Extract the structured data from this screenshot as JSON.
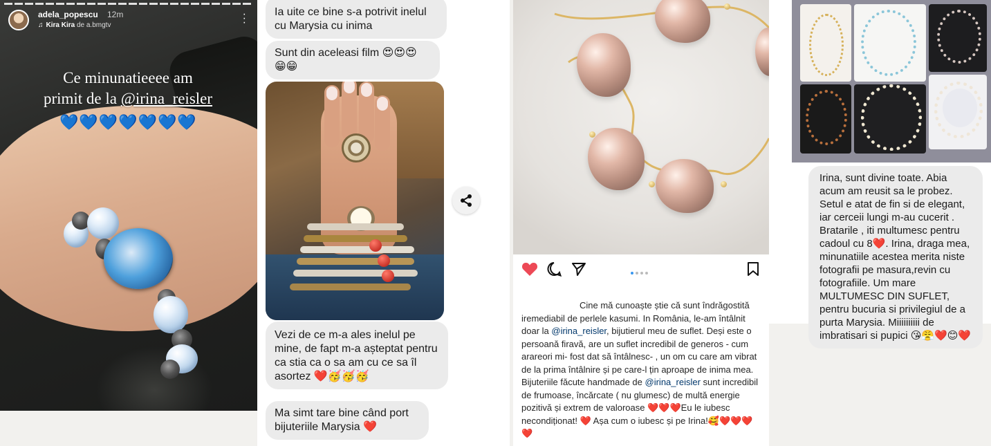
{
  "story": {
    "username": "adela_popescu",
    "time": "12m",
    "music_track": "Kira Kira",
    "music_artist": "de a.bmgtv",
    "caption_line1": "Ce minunatieeee am",
    "caption_line2_prefix": "primit de la ",
    "caption_mention": "@irina_reisler",
    "caption_hearts": "💙💙💙💙💙💙💙"
  },
  "chat": {
    "messages": [
      "Ia uite ce bine s-a potrivit inelul cu Marysia cu inima",
      "Sunt din aceleasi film 😍😍😍 😁😁",
      "Vezi de ce m-a ales inelul pe mine, de fapt m-a așteptat pentru ca stia ca o sa am cu ce sa îl asortez ❤️🥳🥳🥳",
      "Ma simt tare bine când port bijuteriile Marysia ❤️"
    ]
  },
  "post": {
    "carousel_index": 1,
    "carousel_count": 4,
    "text_part1": "Cine mă cunoaște știe că sunt îndrăgostită iremediabil de perlele kasumi. In România, le-am întâlnit doar  la ",
    "mention1": "@irina_reisler",
    "text_part2": ", bijutierul meu de suflet. Deși este o persoană firavă, are un suflet incredibil de generos - cum arareori mi- fost dat să întâlnesc- , un om cu care am vibrat de la prima întâlnire și pe care-l țin aproape de inima mea.  Bijuteriile făcute handmade de ",
    "mention2": "@irina_reisler",
    "text_part3": " sunt incredibil de frumoase, încărcate ( nu glumesc) de multă energie pozitivă și extrem de valoroase ❤️❤️❤️Eu le iubesc necondiționat! ❤️ Așa cum o iubesc și pe Irina!🥰❤️❤️❤️❤️"
  },
  "review": {
    "message": "Irina, sunt divine toate. Abia acum am reusit sa le probez. Setul e atat de fin si de elegant, iar cerceii lungi m-au cucerit . Bratarile , iti multumesc pentru cadoul cu 8❤️. Irina, draga mea, minunatiile acestea merita niste fotografii pe masura,revin cu fotografiile. Um mare MULTUMESC DIN SUFLET, pentru bucuria si privilegiul de a purta Marysia. Miiiiiiiiii de imbratisari si pupici 😘😤❤️😊❤️"
  },
  "colors": {
    "bubble": "#ebebeb",
    "mention": "#00376b",
    "heart_red": "#ed4956",
    "blue_heart": "#2e7fe0"
  },
  "icons": [
    "more-vert-icon",
    "music-icon",
    "share-icon",
    "heart-icon",
    "comment-icon",
    "send-icon",
    "bookmark-icon"
  ]
}
